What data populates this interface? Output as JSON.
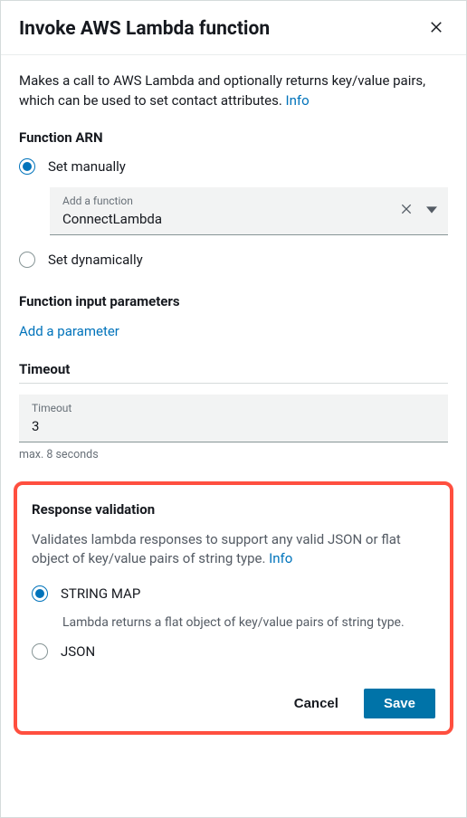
{
  "header": {
    "title": "Invoke AWS Lambda function"
  },
  "description": {
    "text": "Makes a call to AWS Lambda and optionally returns key/value pairs, which can be used to set contact attributes. ",
    "info_label": "Info"
  },
  "function_arn": {
    "label": "Function ARN",
    "set_manually_label": "Set manually",
    "set_dynamically_label": "Set dynamically",
    "selected": "manual",
    "select_placeholder": "Add a function",
    "select_value": "ConnectLambda"
  },
  "input_params": {
    "label": "Function input parameters",
    "add_label": "Add a parameter"
  },
  "timeout": {
    "label": "Timeout",
    "field_label": "Timeout",
    "value": "3",
    "helper": "max. 8 seconds"
  },
  "response_validation": {
    "label": "Response validation",
    "desc_text": "Validates lambda responses to support any valid JSON or flat object of key/value pairs of string type. ",
    "info_label": "Info",
    "string_map_label": "STRING MAP",
    "string_map_desc": "Lambda returns a flat object of key/value pairs of string type.",
    "json_label": "JSON",
    "selected": "string_map"
  },
  "footer": {
    "cancel": "Cancel",
    "save": "Save"
  }
}
